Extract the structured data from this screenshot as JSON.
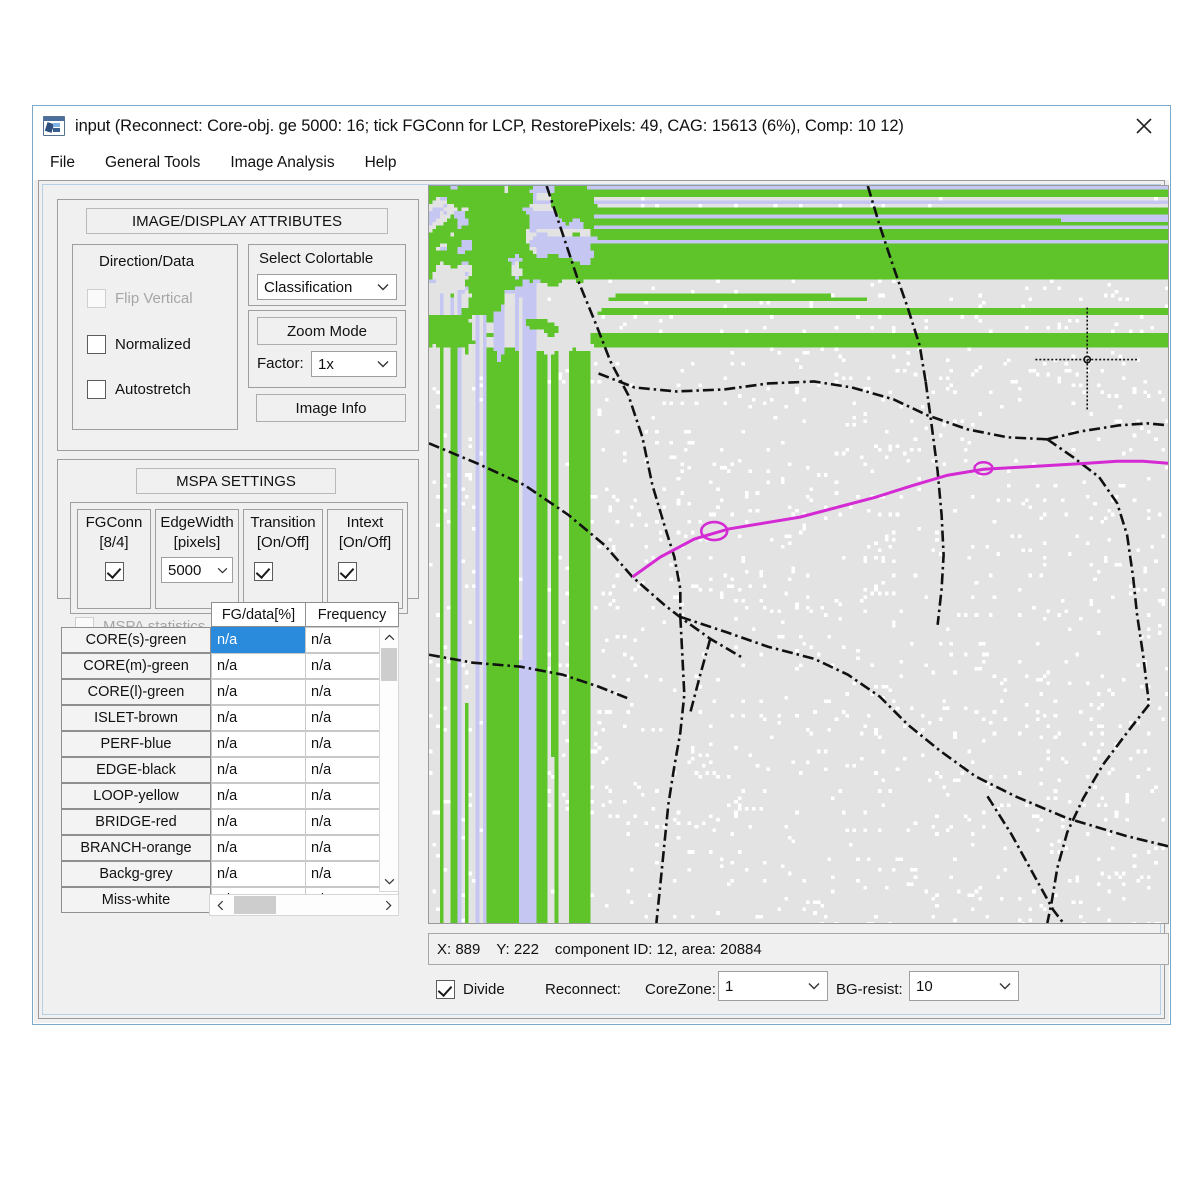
{
  "window": {
    "title": "input (Reconnect:  Core-obj. ge 5000: 16; tick FGConn for LCP, RestorePixels: 49, CAG: 15613 (6%), Comp: 10 12)",
    "app_icon": "image-window-icon",
    "close_label": "✕"
  },
  "menubar": {
    "items": [
      {
        "label": "File"
      },
      {
        "label": "General Tools"
      },
      {
        "label": "Image Analysis"
      },
      {
        "label": "Help"
      }
    ]
  },
  "image_display": {
    "title": "IMAGE/DISPLAY ATTRIBUTES",
    "direction_data": {
      "title": "Direction/Data",
      "flip_vertical": {
        "label": "Flip Vertical",
        "checked": false,
        "enabled": false
      },
      "normalized": {
        "label": "Normalized",
        "checked": false,
        "enabled": true
      },
      "autostretch": {
        "label": "Autostretch",
        "checked": false,
        "enabled": true
      }
    },
    "colortable": {
      "label": "Select Colortable",
      "value": "Classification"
    },
    "zoom": {
      "button_label": "Zoom Mode",
      "factor_label": "Factor:",
      "factor_value": "1x"
    },
    "image_info_label": "Image Info"
  },
  "mspa_settings": {
    "title": "MSPA SETTINGS",
    "options": [
      {
        "name": "fgconn",
        "line1": "FGConn",
        "line2": "[8/4]",
        "type": "checkbox",
        "checked": true
      },
      {
        "name": "edgewidth",
        "line1": "EdgeWidth",
        "line2": "[pixels]",
        "type": "combo",
        "value": "5000"
      },
      {
        "name": "transition",
        "line1": "Transition",
        "line2": "[On/Off]",
        "type": "checkbox",
        "checked": true
      },
      {
        "name": "intext",
        "line1": "Intext",
        "line2": "[On/Off]",
        "type": "checkbox",
        "checked": true
      }
    ],
    "statistics": {
      "label": "MSPA statistics",
      "checked": false,
      "enabled": false
    }
  },
  "table": {
    "columns": [
      "FG/data[%]",
      "Frequency"
    ],
    "rows": [
      {
        "name": "CORE(s)-green",
        "fg": "n/a",
        "freq": "n/a",
        "selected": true
      },
      {
        "name": "CORE(m)-green",
        "fg": "n/a",
        "freq": "n/a",
        "selected": false
      },
      {
        "name": "CORE(l)-green",
        "fg": "n/a",
        "freq": "n/a",
        "selected": false
      },
      {
        "name": "ISLET-brown",
        "fg": "n/a",
        "freq": "n/a",
        "selected": false
      },
      {
        "name": "PERF-blue",
        "fg": "n/a",
        "freq": "n/a",
        "selected": false
      },
      {
        "name": "EDGE-black",
        "fg": "n/a",
        "freq": "n/a",
        "selected": false
      },
      {
        "name": "LOOP-yellow",
        "fg": "n/a",
        "freq": "n/a",
        "selected": false
      },
      {
        "name": "BRIDGE-red",
        "fg": "n/a",
        "freq": "n/a",
        "selected": false
      },
      {
        "name": "BRANCH-orange",
        "fg": "n/a",
        "freq": "n/a",
        "selected": false
      },
      {
        "name": "Backg-grey",
        "fg": "n/a",
        "freq": "n/a",
        "selected": false
      },
      {
        "name": "Miss-white",
        "fg": "n/a",
        "freq": "n/a",
        "selected": false
      }
    ]
  },
  "status": {
    "x_label": "X: 889",
    "y_label": "Y: 222",
    "component": "component ID: 12, area: 20884"
  },
  "map_controls": {
    "divide": {
      "label": "Divide",
      "checked": true
    },
    "reconnect_label": "Reconnect:",
    "corezone_label": "CoreZone:",
    "corezone_value": "1",
    "bgresist_label": "BG-resist:",
    "bgresist_value": "10"
  },
  "map_colors": {
    "background": "#e3e3e3",
    "core_green": "#5ec42a",
    "water_lavender": "#c6c6f2",
    "road_black": "#111111",
    "path_magenta": "#d42ad4",
    "missing_white": "#ffffff"
  }
}
